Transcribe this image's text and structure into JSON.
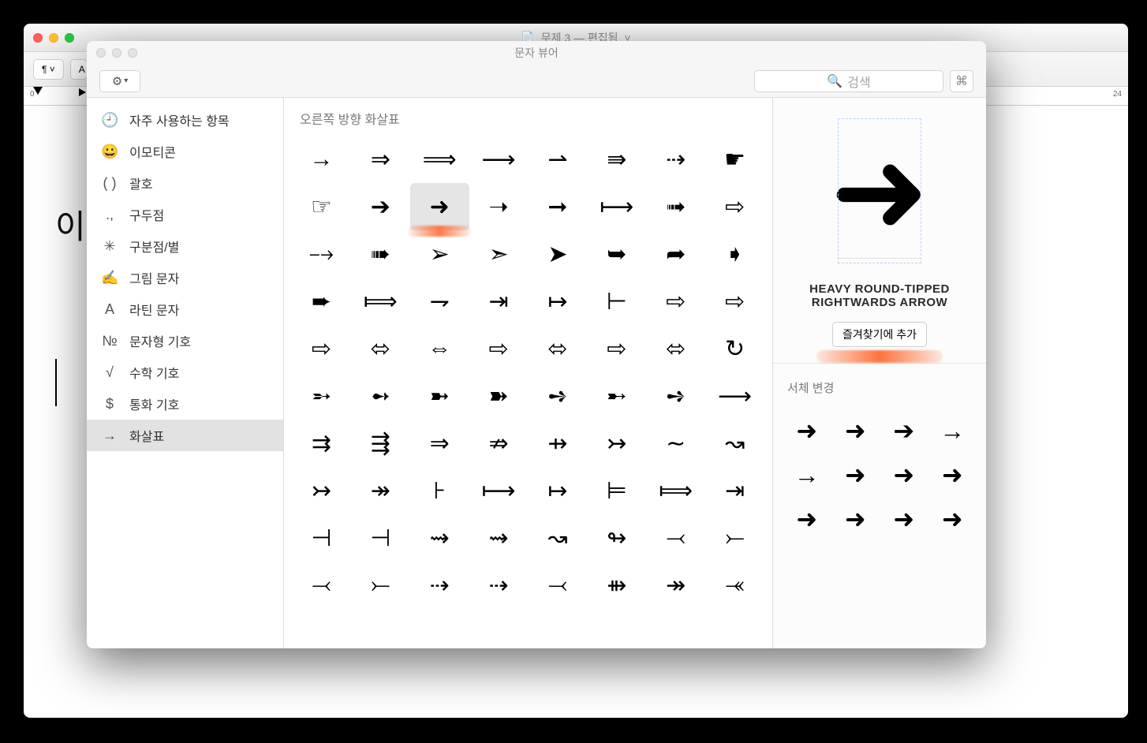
{
  "doc_window": {
    "title": "무제 3 — 편집됨",
    "dropdown_hint": "˅",
    "toolbar_pilcrow": "¶ ˅",
    "ruler_left": "0",
    "ruler_right": "24",
    "body_fragment": "이ᄆ"
  },
  "viewer": {
    "title": "문자 뷰어",
    "search_placeholder": "검색",
    "sidebar": {
      "items": [
        {
          "icon": "🕘",
          "label": "자주 사용하는 항목",
          "selected": false
        },
        {
          "icon": "😀",
          "label": "이모티콘",
          "selected": false
        },
        {
          "icon": "( )",
          "label": "괄호",
          "selected": false
        },
        {
          "icon": ".,",
          "label": "구두점",
          "selected": false
        },
        {
          "icon": "✳",
          "label": "구분점/별",
          "selected": false
        },
        {
          "icon": "✍",
          "label": "그림 문자",
          "selected": false
        },
        {
          "icon": "A",
          "label": "라틴 문자",
          "selected": false
        },
        {
          "icon": "№",
          "label": "문자형 기호",
          "selected": false
        },
        {
          "icon": "√",
          "label": "수학 기호",
          "selected": false
        },
        {
          "icon": "$",
          "label": "통화 기호",
          "selected": false
        },
        {
          "icon": "→",
          "label": "화살표",
          "selected": true
        }
      ]
    },
    "section_header": "오른쪽 방향 화살표",
    "selected_index": 10,
    "characters": [
      "→",
      "⇒",
      "⟹",
      "⟶",
      "⇀",
      "⇛",
      "⇢",
      "☛",
      "☞",
      "➔",
      "➜",
      "➝",
      "➞",
      "⟼",
      "➟",
      "⇨",
      "⤍",
      "➠",
      "➢",
      "➣",
      "➤",
      "➥",
      "➦",
      "➧",
      "➨",
      "⟾",
      "⇁",
      "⇥",
      "↦",
      "⊢",
      "⇨",
      "⇨",
      "⇨",
      "⬄",
      "⇔",
      "⇨",
      "⬄",
      "⇨",
      "⬄",
      "↻",
      "➵",
      "➻",
      "➼",
      "➽",
      "➺",
      "➸",
      "➺",
      "⟶",
      "⇉",
      "⇶",
      "⇒",
      "⇏",
      "⇸",
      "↣",
      "∼",
      "↝",
      "↣",
      "↠",
      "⊦",
      "⟼",
      "↦",
      "⊨",
      "⟾",
      "⇥",
      "⊣",
      "⊣",
      "⇝",
      "⇝",
      "↝",
      "↬",
      "⤙",
      "⤚",
      "⤙",
      "⤚",
      "⇢",
      "⇢",
      "⤙",
      "⇻",
      "↠",
      "⤛"
    ],
    "preview": {
      "glyph": "➜",
      "name": "HEAVY ROUND-TIPPED RIGHTWARDS ARROW",
      "fav_button": "즐겨찾기에 추가",
      "font_change_header": "서체 변경",
      "variants": [
        "➜",
        "➜",
        "➔",
        "→",
        "→",
        "➜",
        "➜",
        "➜",
        "➜",
        "➜",
        "➜",
        "➜"
      ]
    }
  }
}
